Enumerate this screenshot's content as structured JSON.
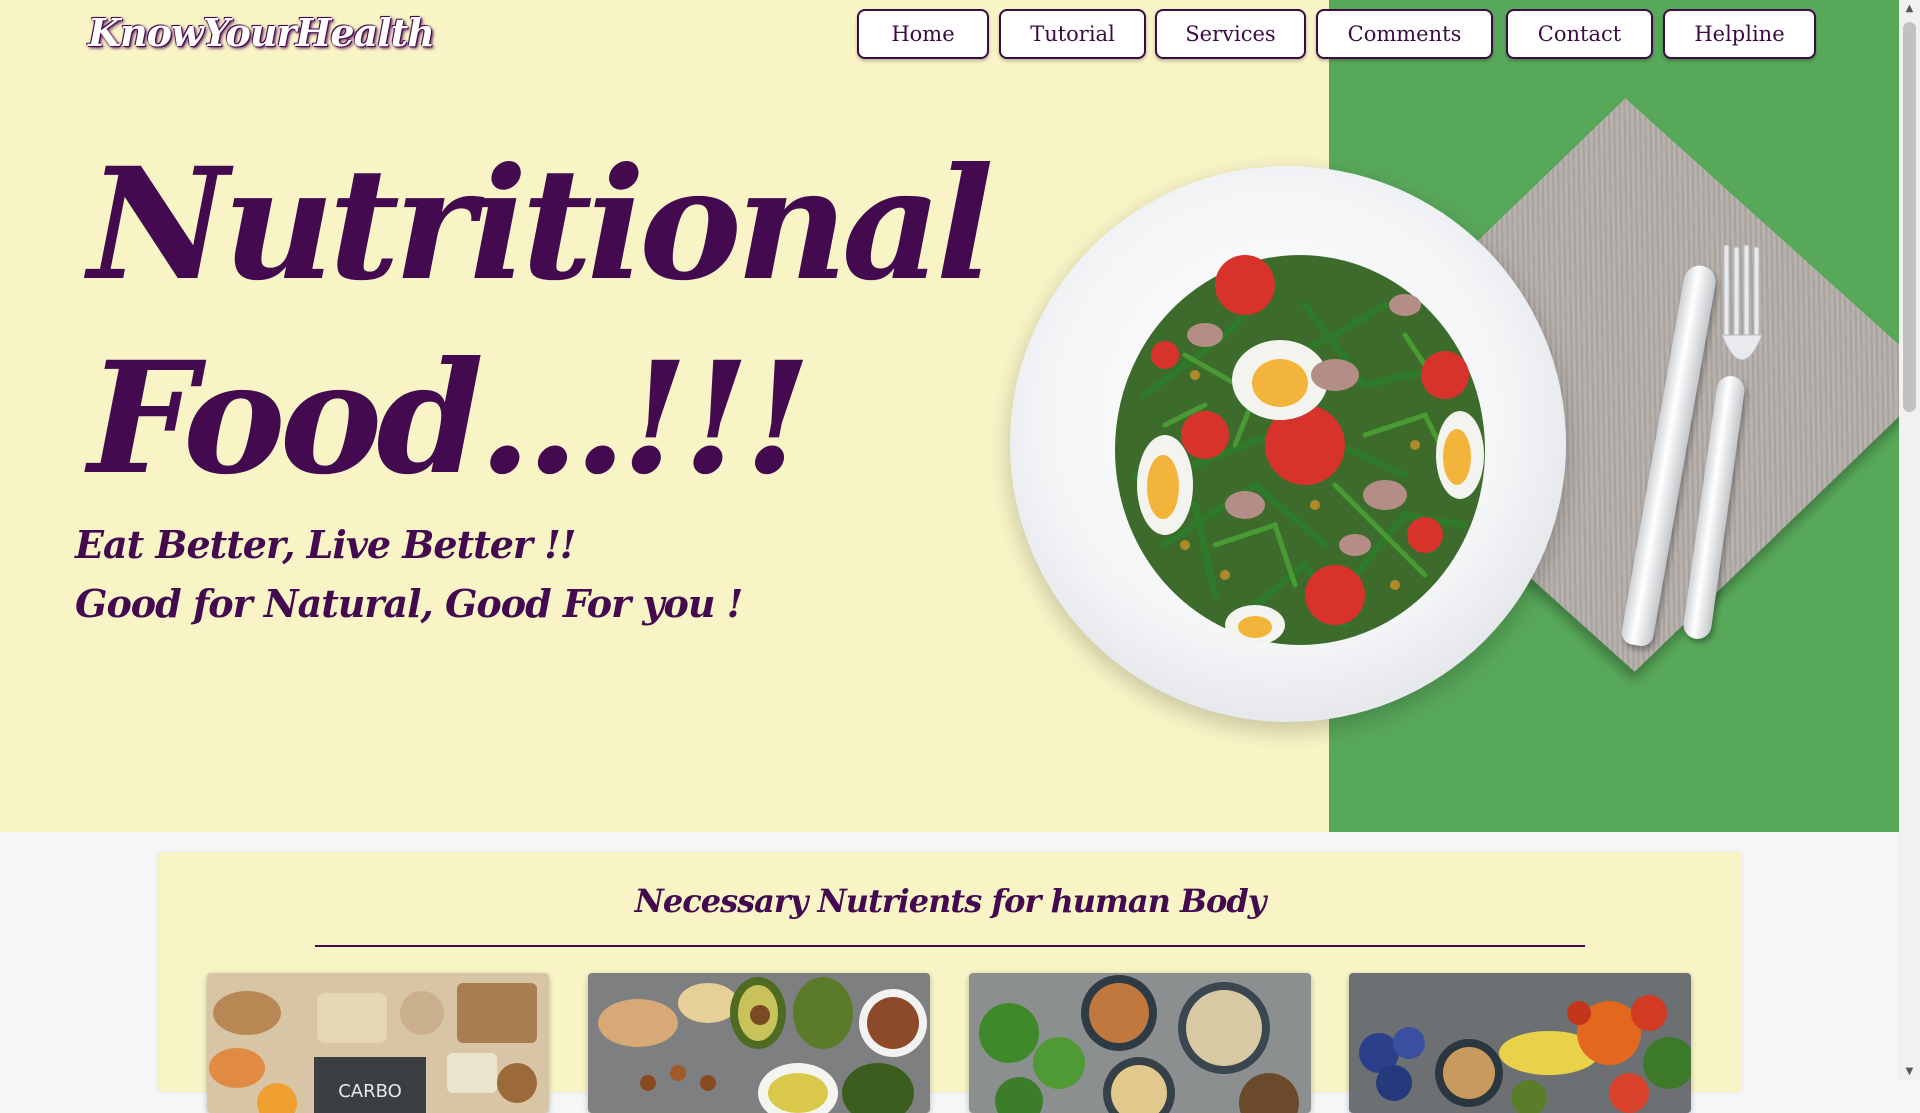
{
  "brand": {
    "logo_text": "KnowYourHealth"
  },
  "nav": {
    "items": [
      {
        "label": "Home"
      },
      {
        "label": "Tutorial"
      },
      {
        "label": "Services"
      },
      {
        "label": "Comments"
      },
      {
        "label": "Contact"
      },
      {
        "label": "Helpline"
      }
    ]
  },
  "hero": {
    "headline_line1": "Nutritional",
    "headline_line2": "Food...!!!",
    "tagline_line1": "Eat Better, Live Better !!",
    "tagline_line2": "Good for Natural, Good For you !",
    "image_icon": "salad-plate-image"
  },
  "nutrients": {
    "title": "Necessary Nutrients for human Body",
    "cards": [
      {
        "icon": "carbohydrates-image",
        "label": "CARBO"
      },
      {
        "icon": "healthy-fats-image"
      },
      {
        "icon": "protein-image"
      },
      {
        "icon": "vitamins-image"
      }
    ]
  },
  "colors": {
    "hero_bg": "#f8f4c6",
    "accent_green": "#58a85a",
    "text_purple": "#430a50",
    "page_bg": "#f5f6f7"
  }
}
